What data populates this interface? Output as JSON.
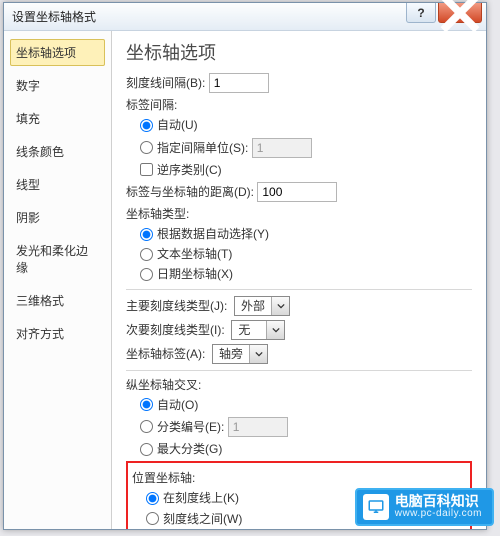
{
  "dialog": {
    "title": "设置坐标轴格式"
  },
  "sidebar": {
    "items": [
      {
        "label": "坐标轴选项"
      },
      {
        "label": "数字"
      },
      {
        "label": "填充"
      },
      {
        "label": "线条颜色"
      },
      {
        "label": "线型"
      },
      {
        "label": "阴影"
      },
      {
        "label": "发光和柔化边缘"
      },
      {
        "label": "三维格式"
      },
      {
        "label": "对齐方式"
      }
    ]
  },
  "content": {
    "heading": "坐标轴选项",
    "tick_interval": {
      "label": "刻度线间隔(B):",
      "value": "1"
    },
    "label_interval": {
      "label": "标签间隔:",
      "auto": "自动(U)",
      "specify": "指定间隔单位(S):",
      "specify_value": "1"
    },
    "reverse": "逆序类别(C)",
    "label_distance": {
      "label": "标签与坐标轴的距离(D):",
      "value": "100"
    },
    "axis_type": {
      "label": "坐标轴类型:",
      "auto": "根据数据自动选择(Y)",
      "text": "文本坐标轴(T)",
      "date": "日期坐标轴(X)"
    },
    "major_tick": {
      "label": "主要刻度线类型(J):",
      "value": "外部"
    },
    "minor_tick": {
      "label": "次要刻度线类型(I):",
      "value": "无"
    },
    "axis_labels": {
      "label": "坐标轴标签(A):",
      "value": "轴旁"
    },
    "v_cross": {
      "label": "纵坐标轴交叉:",
      "auto": "自动(O)",
      "at_cat": "分类编号(E):",
      "at_cat_value": "1",
      "max": "最大分类(G)"
    },
    "position": {
      "label": "位置坐标轴:",
      "on_tick": "在刻度线上(K)",
      "between": "刻度线之间(W)"
    }
  },
  "watermark": {
    "title": "电脑百科知识",
    "url": "www.pc-daily.com"
  }
}
